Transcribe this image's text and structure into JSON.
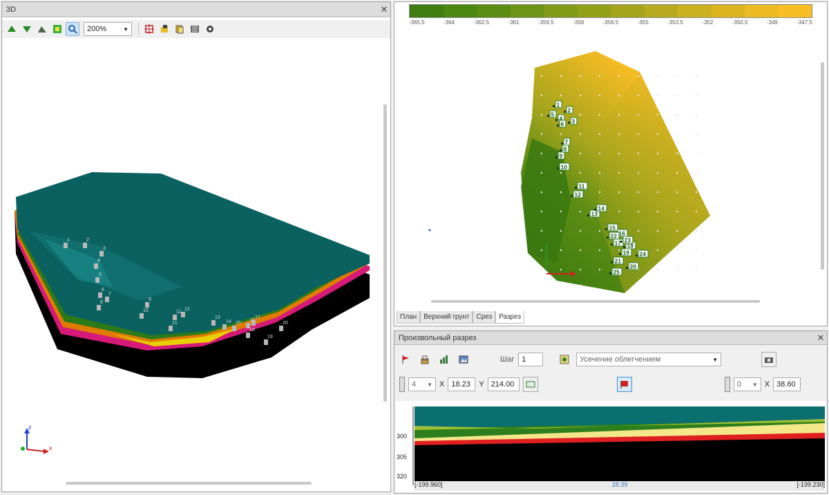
{
  "left_panel": {
    "title": "3D",
    "zoom": "200%",
    "toolbar_icons": [
      "layer-up-icon",
      "layer-down-icon",
      "surface-icon",
      "grid-icon",
      "zoom-icon",
      "crosshair-icon",
      "export-icon",
      "copy-icon",
      "render-icon",
      "settings-icon"
    ],
    "colors": {
      "top_surface": "#0b6060",
      "layer_green": "#2d7a1a",
      "layer_orange": "#e07b00",
      "layer_magenta": "#d61a7a",
      "layer_yellow": "#e0c800",
      "base": "#000000"
    },
    "wells": [
      {
        "id": "1"
      },
      {
        "id": "2"
      },
      {
        "id": "3"
      },
      {
        "id": "4"
      },
      {
        "id": "5"
      },
      {
        "id": "6"
      },
      {
        "id": "7"
      },
      {
        "id": "8"
      },
      {
        "id": "9"
      },
      {
        "id": "10"
      },
      {
        "id": "11"
      },
      {
        "id": "12"
      },
      {
        "id": "13"
      },
      {
        "id": "14"
      },
      {
        "id": "15"
      },
      {
        "id": "16"
      },
      {
        "id": "17"
      },
      {
        "id": "18"
      },
      {
        "id": "19"
      },
      {
        "id": "20"
      },
      {
        "id": "21"
      }
    ],
    "axis_labels": {
      "x": "x",
      "z": "z"
    }
  },
  "right_panel": {
    "legend_colors": [
      "#3f7d10",
      "#4b8512",
      "#5b8c14",
      "#6e9416",
      "#819b18",
      "#93a01a",
      "#a5a51c",
      "#b8aa1e",
      "#cbb020",
      "#dcb420",
      "#ecba22",
      "#f8be24"
    ],
    "legend_ticks": [
      "-365.5",
      "-364",
      "-362.5",
      "-361",
      "-359.5",
      "-358",
      "-356.5",
      "-355",
      "-353.5",
      "-352",
      "-350.5",
      "-349",
      "-347.5"
    ],
    "tabs": [
      "План",
      "Верхний грунт",
      "Срез",
      "Разрез"
    ],
    "active_tab": "Разрез",
    "map_wells": [
      {
        "id": "1"
      },
      {
        "id": "2"
      },
      {
        "id": "3"
      },
      {
        "id": "4"
      },
      {
        "id": "5"
      },
      {
        "id": "6"
      },
      {
        "id": "7"
      },
      {
        "id": "8"
      },
      {
        "id": "9"
      },
      {
        "id": "10"
      },
      {
        "id": "11"
      },
      {
        "id": "12"
      },
      {
        "id": "13"
      },
      {
        "id": "14"
      },
      {
        "id": "15"
      },
      {
        "id": "16"
      },
      {
        "id": "17"
      },
      {
        "id": "18"
      },
      {
        "id": "19"
      },
      {
        "id": "20"
      },
      {
        "id": "21"
      },
      {
        "id": "22"
      },
      {
        "id": "23"
      },
      {
        "id": "24"
      },
      {
        "id": "25"
      }
    ]
  },
  "section_panel": {
    "title": "Произвольный разрез",
    "step_label": "Шаг",
    "step_value": "1",
    "method": "Усечение облегчением",
    "start_point": {
      "index": "4",
      "x_label": "X",
      "x": "18.23",
      "y_label": "Y",
      "y": "214.00"
    },
    "end_point": {
      "index": "0",
      "x_label": "X",
      "x": "38.60"
    },
    "depth_ticks": [
      "300",
      "305",
      "320"
    ],
    "footer_left": "[-199.960]",
    "footer_center": "28.39",
    "footer_right": "[-199.230]",
    "layer_colors": {
      "top": "#0b6f70",
      "green": "#2c7f1c",
      "yellow": "#f3e78a",
      "red": "#e02020",
      "black": "#000000"
    }
  }
}
